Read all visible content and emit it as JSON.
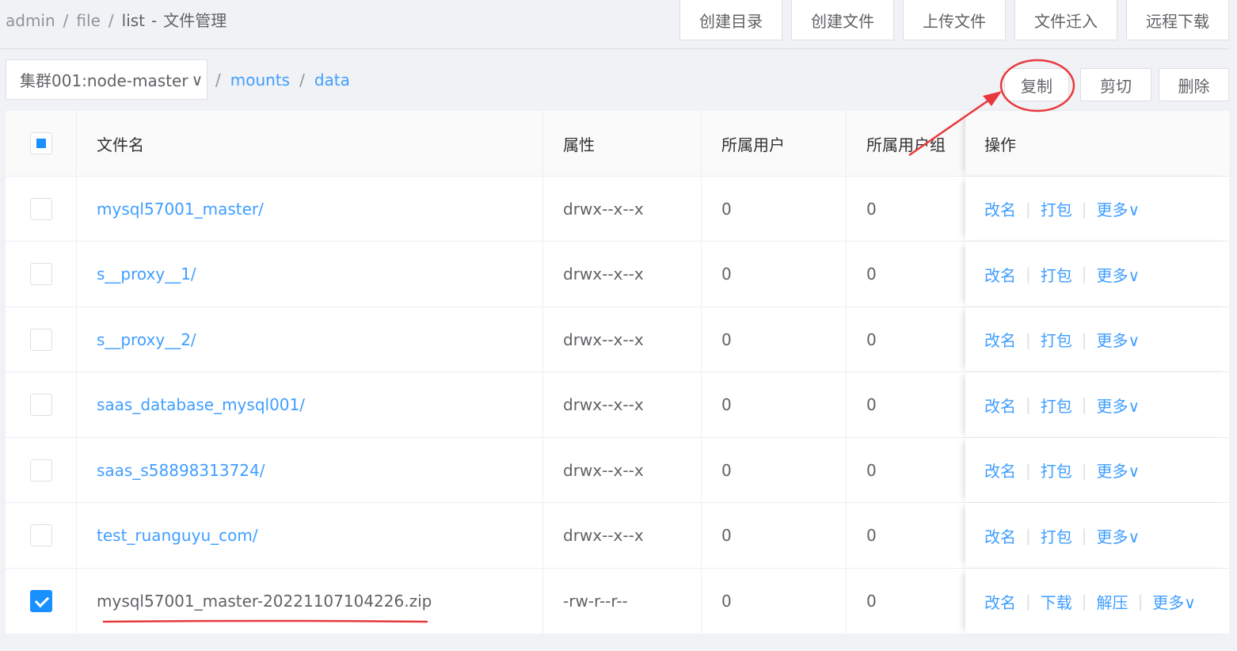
{
  "breadcrumb": {
    "items": [
      "admin",
      "file",
      "list"
    ],
    "separator": "/",
    "dash": "-",
    "title": "文件管理"
  },
  "toolbar": {
    "create_dir": "创建目录",
    "create_file": "创建文件",
    "upload_file": "上传文件",
    "migrate_file": "文件迁入",
    "remote_download": "远程下载"
  },
  "node_select": {
    "value": "集群001:node-master",
    "chevron": "∨"
  },
  "path": {
    "separator": "/",
    "segments": [
      "mounts",
      "data"
    ]
  },
  "actions": {
    "copy": "复制",
    "cut": "剪切",
    "delete": "删除"
  },
  "table": {
    "headers": {
      "name": "文件名",
      "attr": "属性",
      "user": "所属用户",
      "group": "所属用户组",
      "op": "操作"
    },
    "ops": {
      "rename": "改名",
      "pack": "打包",
      "more": "更多∨",
      "download": "下载",
      "unzip": "解压"
    },
    "rows": [
      {
        "name": "mysql57001_master/",
        "attr": "drwx--x--x",
        "user": "0",
        "group": "0",
        "checked": false
      },
      {
        "name": "s__proxy__1/",
        "attr": "drwx--x--x",
        "user": "0",
        "group": "0",
        "checked": false
      },
      {
        "name": "s__proxy__2/",
        "attr": "drwx--x--x",
        "user": "0",
        "group": "0",
        "checked": false
      },
      {
        "name": "saas_database_mysql001/",
        "attr": "drwx--x--x",
        "user": "0",
        "group": "0",
        "checked": false
      },
      {
        "name": "saas_s58898313724/",
        "attr": "drwx--x--x",
        "user": "0",
        "group": "0",
        "checked": false
      },
      {
        "name": "test_ruanguyu_com/",
        "attr": "drwx--x--x",
        "user": "0",
        "group": "0",
        "checked": false
      },
      {
        "name": "mysql57001_master-20221107104226.zip",
        "attr": "-rw-r--r--",
        "user": "0",
        "group": "0",
        "checked": true
      }
    ]
  },
  "colors": {
    "accent": "#409eff",
    "checkbox": "#1890ff",
    "annotation": "#e8383d"
  }
}
